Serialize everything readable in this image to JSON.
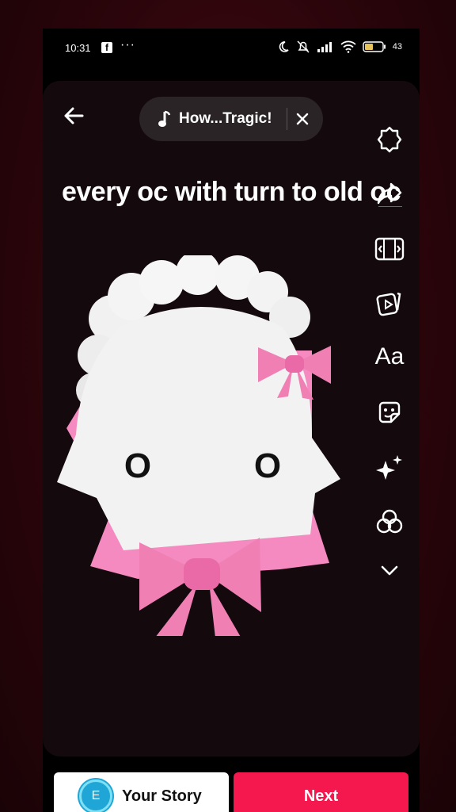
{
  "status_bar": {
    "time": "10:31",
    "notification_app": "f",
    "more_dots": "···",
    "battery_text": "43",
    "icons": [
      "moon-icon",
      "mute-bell-icon",
      "signal-icon",
      "wifi-icon",
      "battery-icon"
    ]
  },
  "editor": {
    "sound_label": "How...Tragic!",
    "caption": "every oc with turn to old oc",
    "rail_text_tool": "Aa",
    "eye_left": "O",
    "eye_right": "O",
    "rail_tools": [
      "settings-icon",
      "share-arrow-icon",
      "resize-icon",
      "video-template-icon",
      "text-tool",
      "sticker-icon",
      "effects-sparkle-icon",
      "filters-icon",
      "chevron-down-icon"
    ]
  },
  "bottom_bar": {
    "avatar_letter": "E",
    "your_story_label": "Your Story",
    "next_label": "Next"
  },
  "colors": {
    "background_outer": "#2b050b",
    "editor_bg": "#140a0d",
    "next_button": "#f5184f",
    "avatar": "#1fa6d6",
    "bow_pink": "#f07fb4"
  }
}
